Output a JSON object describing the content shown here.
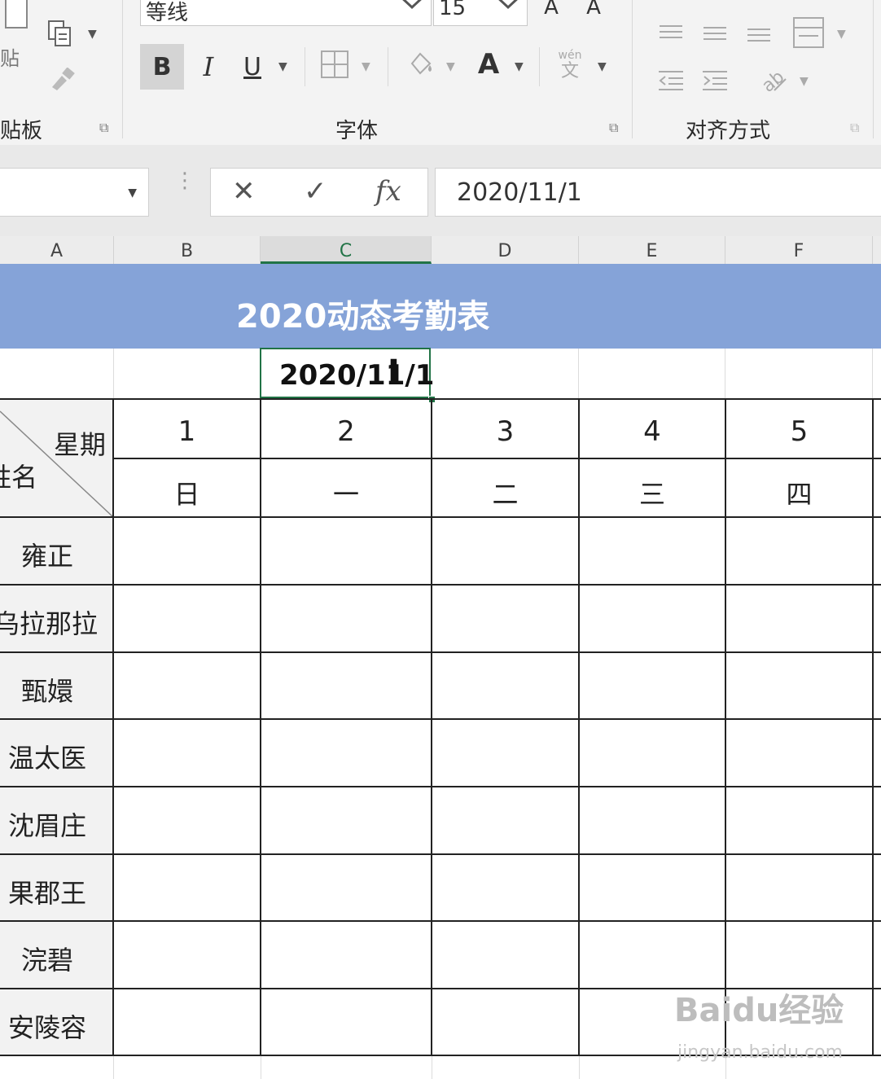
{
  "ribbon": {
    "clipboard": {
      "label": "贴板",
      "paste_label": "贴"
    },
    "font": {
      "label": "字体",
      "font_name": "等线",
      "font_size": "15",
      "bold": "B",
      "italic": "I",
      "underline": "U",
      "font_color_glyph": "A",
      "pinyin_glyph": "wén",
      "pinyin_sub": "文",
      "grow_glyph": "A",
      "shrink_glyph": "A"
    },
    "alignment": {
      "label": "对齐方式"
    }
  },
  "formula_bar": {
    "cancel": "✕",
    "enter": "✓",
    "fx": "fx",
    "value": "2020/11/1"
  },
  "columns": [
    "A",
    "B",
    "C",
    "D",
    "E",
    "F"
  ],
  "sheet": {
    "title": "2020动态考勤表",
    "active_cell_value": "2020/11/1",
    "header_weekday_label": "星期",
    "header_name_label": "姓名",
    "days": [
      "1",
      "2",
      "3",
      "4",
      "5"
    ],
    "weekdays": [
      "日",
      "一",
      "二",
      "三",
      "四"
    ],
    "names": [
      "雍正",
      "乌拉那拉",
      "甄嬛",
      "温太医",
      "沈眉庄",
      "果郡王",
      "浣碧",
      "安陵容"
    ]
  },
  "watermark": {
    "brand": "Baidu经验",
    "url": "jingyan.baidu.com"
  },
  "colors": {
    "title_band": "#85a3d8",
    "selection": "#217346"
  }
}
